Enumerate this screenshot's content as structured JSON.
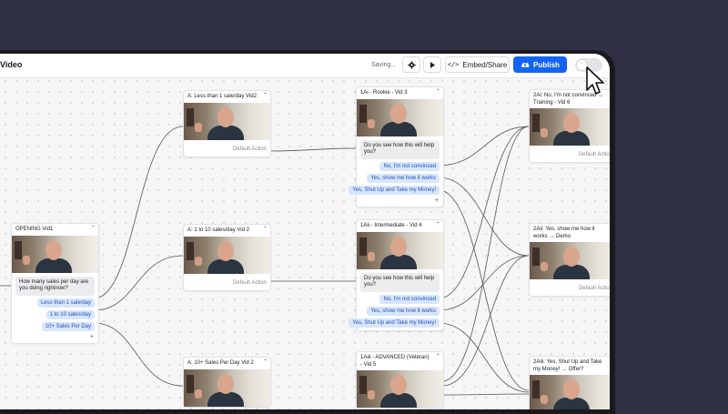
{
  "toolbar": {
    "title": "Video",
    "saving": "Saving...",
    "embed_label": "Embed/Share",
    "publish_label": "Publish"
  },
  "nodes": {
    "opening": {
      "title": "OPENING Vid1",
      "question": "How many sales per day are you doing rightnow?",
      "answers": [
        "Less than 1 sale/day",
        "1 to 10 sales/day",
        "10+ Sales Per Day"
      ]
    },
    "a1": {
      "title": "A: Less than 1 sale/day Vid2",
      "default_action": "Default Action"
    },
    "a2": {
      "title": "A: 1 to 10 sales/day Vid 2",
      "default_action": "Default Action"
    },
    "a3": {
      "title": "A: 10+ Sales Per Day Vid 2"
    },
    "r1": {
      "title": "1Ai - Rookie - Vid 3",
      "question": "Do you see how this will help you?",
      "answers": [
        "No, I'm not convinced",
        "Yes, show me how it works",
        "Yes, Shut Up and Take my Money!"
      ]
    },
    "r2": {
      "title": "1Aii - Intermediate - Vid 4",
      "question": "Do you see how this will help you?",
      "answers": [
        "No, I'm not convinced",
        "Yes, show me how it works",
        "Yes, Shut Up and Take my Money!"
      ]
    },
    "r3": {
      "title": "1Aiii - ADVANCED (Veteran) - Vid 5"
    },
    "c1": {
      "title": "2Ai: No, I'm not convinced → Training - Vid 6",
      "default_action": "Default Action"
    },
    "c2": {
      "title": "2Aii: Yes, show me how it works → Demo",
      "default_action": "Default Action"
    },
    "c3": {
      "title": "2Aiii: Yes, Shut Up and Take my Money! → Offer?"
    }
  },
  "colors": {
    "accent": "#1463f3",
    "answer_bg": "#d7e6fc",
    "answer_text": "#1f4fb8"
  },
  "icons": [
    "gear-icon",
    "play-icon",
    "code-icon",
    "cloud-upload-icon",
    "chevron-up-icon",
    "plus-icon",
    "cursor-icon"
  ]
}
